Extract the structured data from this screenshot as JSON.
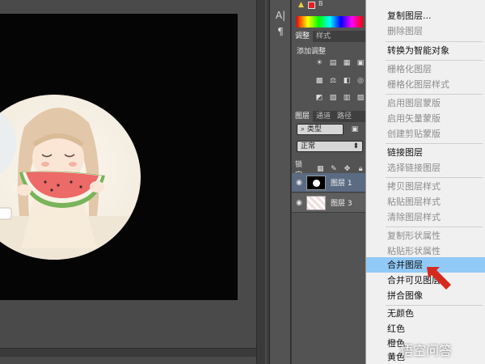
{
  "panels": {
    "adjustments_tabs": [
      "调整",
      "样式"
    ],
    "add_adjustment_label": "添加调整",
    "layers_tabs": [
      "图层",
      "通道",
      "路径"
    ],
    "filter_kind": "类型",
    "blend_mode": "正常",
    "lock_label": "锁定:",
    "layers": [
      {
        "name": "图层 1",
        "selected": true
      },
      {
        "name": "图层 3",
        "selected": false
      }
    ]
  },
  "menu": {
    "items": [
      {
        "label": "复制图层...",
        "disabled": false
      },
      {
        "label": "删除图层",
        "disabled": true
      },
      {
        "label": "转换为智能对象",
        "disabled": false
      },
      {
        "label": "栅格化图层",
        "disabled": true
      },
      {
        "label": "栅格化图层样式",
        "disabled": true
      },
      {
        "label": "启用图层蒙版",
        "disabled": true
      },
      {
        "label": "启用矢量蒙版",
        "disabled": true
      },
      {
        "label": "创建剪贴蒙版",
        "disabled": true
      },
      {
        "label": "链接图层",
        "disabled": false
      },
      {
        "label": "选择链接图层",
        "disabled": true
      },
      {
        "label": "拷贝图层样式",
        "disabled": true
      },
      {
        "label": "粘贴图层样式",
        "disabled": true
      },
      {
        "label": "清除图层样式",
        "disabled": true
      },
      {
        "label": "复制形状属性",
        "disabled": true
      },
      {
        "label": "粘贴形状属性",
        "disabled": true
      },
      {
        "label": "合并图层",
        "disabled": false,
        "highlighted": true
      },
      {
        "label": "合并可见图层",
        "disabled": false
      },
      {
        "label": "拼合图像",
        "disabled": false
      },
      {
        "label": "无颜色",
        "disabled": false
      },
      {
        "label": "红色",
        "disabled": false
      },
      {
        "label": "橙色",
        "disabled": false
      },
      {
        "label": "黄色",
        "disabled": false
      }
    ]
  },
  "watermark": "悟空问答",
  "colors": {
    "menu_highlight": "#91c9f7",
    "arrow": "#d62a1e",
    "selected_layer": "#5a6b82"
  }
}
